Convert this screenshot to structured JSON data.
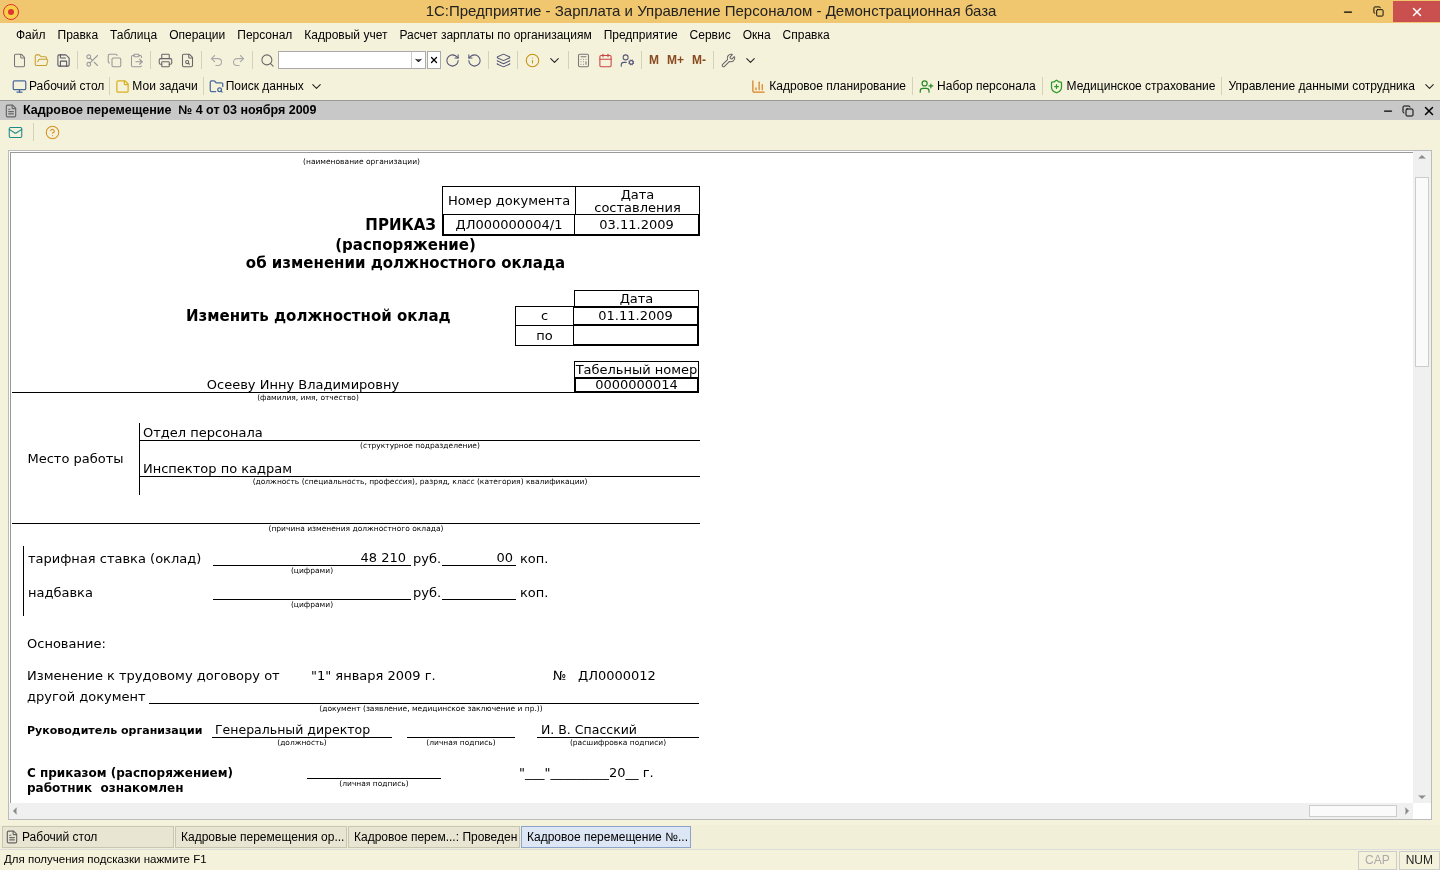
{
  "window": {
    "title": "1С:Предприятие - Зарплата и Управление Персоналом - Демонстрационная база"
  },
  "menu": [
    "Файл",
    "Правка",
    "Таблица",
    "Операции",
    "Персонал",
    "Кадровый учет",
    "Расчет зарплаты по организациям",
    "Предприятие",
    "Сервис",
    "Окна",
    "Справка"
  ],
  "memory_buttons": [
    "M",
    "M+",
    "M-"
  ],
  "panel_left": [
    "Рабочий стол",
    "Мои задачи",
    "Поиск данных"
  ],
  "panel_right": [
    "Кадровое планирование",
    "Набор персонала",
    "Медицинское страхование",
    "Управление данными сотрудника"
  ],
  "document_window": {
    "title": "Кадровое перемещение  № 4 от 03 ноября 2009"
  },
  "form": {
    "org_caption": "(наименование организации)",
    "doc_table": {
      "headers": [
        "Номер документа",
        "Дата составления"
      ],
      "values": [
        "ДЛ000000004/1",
        "03.11.2009"
      ]
    },
    "title": "ПРИКАЗ",
    "subtitle": "(распоряжение)",
    "subject": "об изменении должностного оклада",
    "action": "Изменить должностной оклад",
    "period": {
      "header": "Дата",
      "rows": [
        {
          "label": "с",
          "value": "01.11.2009"
        },
        {
          "label": "по"
        }
      ]
    },
    "employee": {
      "name": "Осееву Инну Владимировну",
      "caption": "(фамилия, имя, отчество)",
      "tab_header": "Табельный номер",
      "tab_number": "0000000014"
    },
    "workplace": {
      "label": "Место работы",
      "lines": [
        {
          "value": "Отдел персонала",
          "caption": "(структурное подразделение)"
        },
        {
          "value": "Инспектор по кадрам",
          "caption": "(должность (специальность, профессия), разряд, класс (категория) квалификации)"
        }
      ]
    },
    "reason_caption": "(причина изменения должностного оклада)",
    "pay": [
      {
        "label": "тарифная ставка (оклад)",
        "rub": "48 210",
        "rub_unit": "руб.",
        "kop": "00",
        "kop_unit": "коп.",
        "caption": "(цифрами)"
      },
      {
        "label": "надбавка",
        "rub_unit": "руб.",
        "kop_unit": "коп.",
        "caption": "(цифрами)"
      }
    ],
    "basis_label": "Основание:",
    "contract": {
      "label": "Изменение к трудовому договору от",
      "date": "\"1\" января 2009 г.",
      "number_label": "№",
      "number": "ДЛ0000012"
    },
    "other_doc": {
      "label": "другой документ",
      "caption": "(документ (заявление, медицинское заключение и пр.))"
    },
    "head": {
      "label": "Руководитель организации",
      "position": "Генеральный директор",
      "position_caption": "(должность)",
      "signature_caption": "(личная подпись)",
      "name": "И. В. Спасский",
      "name_caption": "(расшифровка подписи)"
    },
    "ack": {
      "label_lines": [
        "С приказом (распоряжением)",
        "работник  ознакомлен"
      ],
      "signature_caption": "(личная подпись)",
      "date_line": "\"___\"_________20__ г."
    }
  },
  "taskbar": [
    {
      "label": "Рабочий стол",
      "selected": false
    },
    {
      "label": "Кадровые перемещения ор...",
      "selected": false
    },
    {
      "label": "Кадровое перем...: Проведен",
      "selected": false
    },
    {
      "label": "Кадровое перемещение  №...",
      "selected": true
    }
  ],
  "status_bar": {
    "hint": "Для получения подсказки нажмите F1",
    "indicators": [
      {
        "label": "CAP",
        "on": false
      },
      {
        "label": "NUM",
        "on": true
      }
    ]
  }
}
